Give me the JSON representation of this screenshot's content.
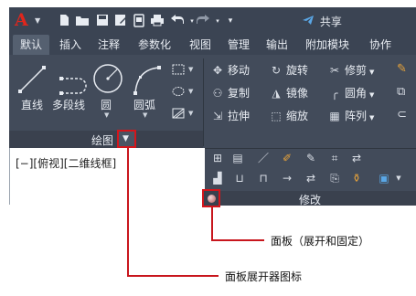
{
  "app": {
    "logo": "A"
  },
  "quick_access": {
    "share_label": "共享"
  },
  "tabs": [
    {
      "label": "默认",
      "active": true
    },
    {
      "label": "插入"
    },
    {
      "label": "注释"
    },
    {
      "label": "参数化"
    },
    {
      "label": "视图"
    },
    {
      "label": "管理"
    },
    {
      "label": "输出"
    },
    {
      "label": "附加模块"
    },
    {
      "label": "协作"
    }
  ],
  "draw_panel": {
    "title": "绘图",
    "tools": {
      "line": "直线",
      "polyline": "多段线",
      "circle": "圆",
      "arc": "圆弧"
    }
  },
  "modify_panel": {
    "title": "修改",
    "tools": {
      "move": "移动",
      "rotate": "旋转",
      "trim": "修剪",
      "copy": "复制",
      "mirror": "镜像",
      "fillet": "圆角",
      "stretch": "拉伸",
      "scale": "缩放",
      "array": "阵列"
    }
  },
  "viewport": {
    "label": "[−][俯视][二维线框]"
  },
  "callouts": {
    "pin": "面板（展开和固定）",
    "expander": "面板展开器图标"
  },
  "colors": {
    "ribbon_bg": "#424b5a",
    "accent_red": "#d4151b",
    "logo_red": "#e0261c",
    "share_blue": "#5aa7e6"
  }
}
